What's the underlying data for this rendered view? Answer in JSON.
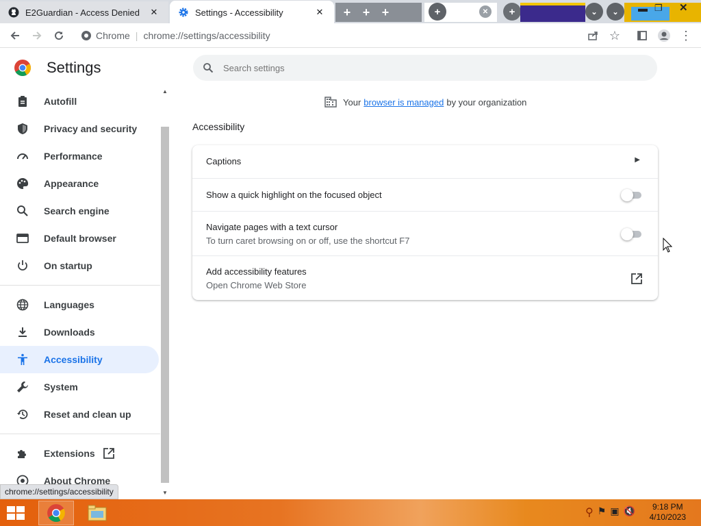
{
  "tabs": [
    {
      "title": "E2Guardian - Access Denied",
      "icon": "github-icon"
    },
    {
      "title": "Settings - Accessibility",
      "icon": "settings-gear-icon",
      "active": true
    }
  ],
  "toolbar": {
    "site_label": "Chrome",
    "url": "chrome://settings/accessibility"
  },
  "sidebar": {
    "title": "Settings",
    "items": [
      {
        "label": "Autofill",
        "icon": "clipboard-icon"
      },
      {
        "label": "Privacy and security",
        "icon": "shield-icon"
      },
      {
        "label": "Performance",
        "icon": "gauge-icon"
      },
      {
        "label": "Appearance",
        "icon": "palette-icon"
      },
      {
        "label": "Search engine",
        "icon": "search-icon"
      },
      {
        "label": "Default browser",
        "icon": "browser-window-icon"
      },
      {
        "label": "On startup",
        "icon": "power-icon"
      },
      {
        "label": "Languages",
        "icon": "globe-icon"
      },
      {
        "label": "Downloads",
        "icon": "download-icon"
      },
      {
        "label": "Accessibility",
        "icon": "accessibility-icon",
        "active": true
      },
      {
        "label": "System",
        "icon": "wrench-icon"
      },
      {
        "label": "Reset and clean up",
        "icon": "history-icon"
      },
      {
        "label": "Extensions",
        "icon": "puzzle-icon"
      },
      {
        "label": "About Chrome",
        "icon": "chrome-icon"
      }
    ]
  },
  "search": {
    "placeholder": "Search settings"
  },
  "managed": {
    "prefix": "Your",
    "link": "browser is managed",
    "suffix": "by your organization"
  },
  "section": {
    "title": "Accessibility"
  },
  "rows": {
    "captions": {
      "title": "Captions"
    },
    "highlight": {
      "title": "Show a quick highlight on the focused object",
      "enabled": false
    },
    "caret": {
      "title": "Navigate pages with a text cursor",
      "subtitle": "To turn caret browsing on or off, use the shortcut F7",
      "enabled": false
    },
    "add_features": {
      "title": "Add accessibility features",
      "subtitle": "Open Chrome Web Store"
    }
  },
  "status_url": "chrome://settings/accessibility",
  "taskbar": {
    "time": "9:18 PM",
    "date": "4/10/2023"
  },
  "colors": {
    "accent": "#1a73e8",
    "active_nav_bg": "#e8f0fe",
    "taskbar_orange": "#e4600c"
  }
}
